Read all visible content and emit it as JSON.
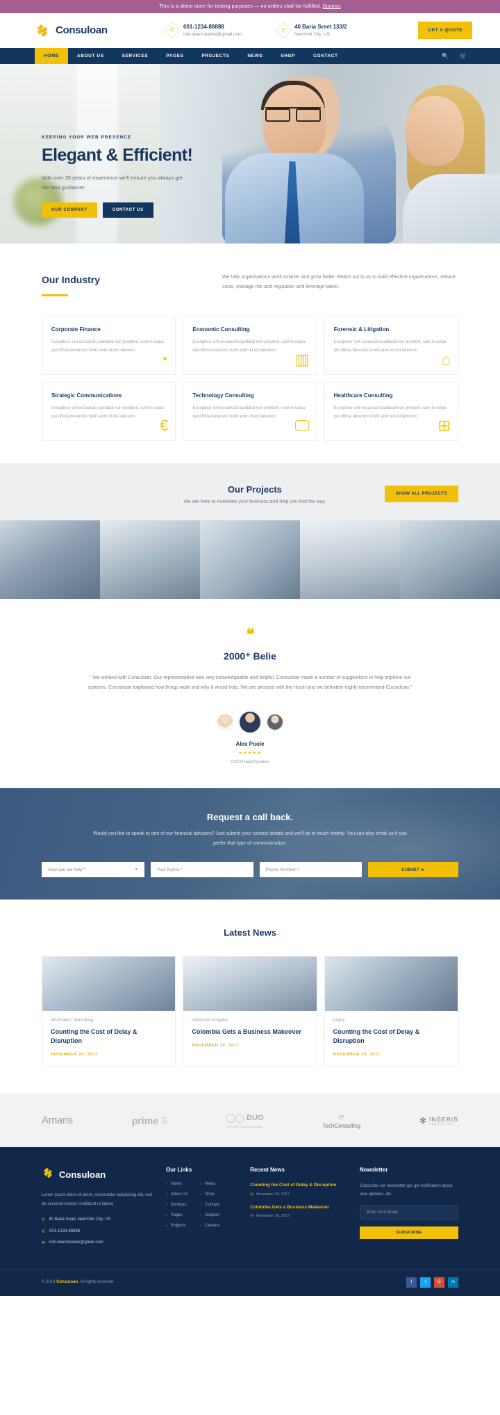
{
  "notice": {
    "text": "This is a demo store for testing purposes — no orders shall be fulfilled.",
    "link": "Dismiss"
  },
  "header": {
    "brand": "Consuloan",
    "phone": {
      "title": "001-1234-88888",
      "sub": "info.deercreative@gmail.com",
      "icon": "phone-icon"
    },
    "address": {
      "title": "40 Baria Sreet 133/2",
      "sub": "NewYork City, US",
      "icon": "map-pin-icon"
    },
    "quote_button": "GET A QUOTE"
  },
  "nav": {
    "items": [
      {
        "label": "HOME",
        "active": true
      },
      {
        "label": "ABOUT US",
        "active": false
      },
      {
        "label": "SERVICES",
        "active": false
      },
      {
        "label": "PAGES",
        "active": false
      },
      {
        "label": "PROJECTS",
        "active": false
      },
      {
        "label": "NEWS",
        "active": false
      },
      {
        "label": "SHOP",
        "active": false
      },
      {
        "label": "CONTACT",
        "active": false
      }
    ],
    "search_icon": "search-icon",
    "cart_icon": "cart-icon"
  },
  "hero": {
    "eyebrow": "KEEPING YOUR WEB PRESENCE",
    "title": "Elegant & Efficient!",
    "subtitle": "With over 20 years of experience we'll ensure you always get the best guidance!",
    "btn_primary": "OUR COMPANY",
    "btn_secondary": "CONTACT US"
  },
  "industry": {
    "title": "Our Industry",
    "description": "We help organisations work smarter and grow faster. Reach out to us to build effective organisations, reduce costs, manage risk and regulation and leverage talent.",
    "body": "Excepteur sint occaecat cupidatat non proident, sunt in culpa qui officia deserunt mollit anim id est laborum",
    "cards": [
      {
        "title": "Corporate Finance",
        "icon": "pie-chart-icon",
        "glyph": "◔"
      },
      {
        "title": "Economic Consulting",
        "icon": "bar-chart-icon",
        "glyph": "▥"
      },
      {
        "title": "Forensic & Litigation",
        "icon": "bell-icon",
        "glyph": "⌂"
      },
      {
        "title": "Strategic Communications",
        "icon": "euro-icon",
        "glyph": "€"
      },
      {
        "title": "Technology Consulting",
        "icon": "monitor-icon",
        "glyph": "🖵"
      },
      {
        "title": "Healthcare Consulting",
        "icon": "medical-case-icon",
        "glyph": "⊞"
      }
    ]
  },
  "projects": {
    "title": "Our Projects",
    "subtitle": "We are here to Acelerate your business and help you find the way.",
    "button": "SHOW ALL PROJECTS",
    "thumbs": [
      "project-thumb-1",
      "project-thumb-2",
      "project-thumb-3",
      "project-thumb-4",
      "project-thumb-5"
    ]
  },
  "testimonial": {
    "quote_icon": "quote-icon",
    "title": "2000⁺ Belie",
    "body": "\" We worked with Consuloan. Our representative was very knowledgeable and helpful. Consuloan made a number of suggestions to help improve our systems. Consuloan explained how things work and why it would help. We are pleased with the result and we definitely highly recommend Consuloan.\"",
    "name": "Alex Poole",
    "stars": "★★★★★",
    "role": "CEO DeerCreative"
  },
  "callback": {
    "title": "Request a call back.",
    "subtitle": "Would you like to speak to one of our financial advisers? Just submit your contact details and we'll be in touch shortly. You can also email us if you prefer that type of communication.",
    "select_placeholder": "How can we help:*",
    "name_placeholder": "Your Name:*",
    "phone_placeholder": "Phone Number:*",
    "submit": "SUBMIT ➤"
  },
  "news": {
    "title": "Latest News",
    "cards": [
      {
        "category": "Information Technology",
        "headline": "Counting the Cost of Delay & Disruption",
        "date": "NOVEMBER 30, 2017",
        "image": "news-image-1"
      },
      {
        "category": "Advanced Analytics",
        "headline": "Colombia Gets a Business Makeover",
        "date": "NOVEMBER 30, 2017",
        "image": "news-image-2"
      },
      {
        "category": "Digital",
        "headline": "Counting the Cost of Delay & Disruption",
        "date": "NOVEMBER 30, 2017",
        "image": "news-image-3"
      }
    ]
  },
  "clients": [
    {
      "name": "Amaris",
      "sub": ""
    },
    {
      "name": "prime",
      "sub": ""
    },
    {
      "name": "DUO",
      "sub": "A CIGNEX Datamatics Company"
    },
    {
      "name": "TechConsulting",
      "sub": ""
    },
    {
      "name": "INGERIS",
      "sub": "CONSULTING"
    }
  ],
  "footer": {
    "brand": "Consuloan",
    "about": "Lorem ipsum dolor sit amet, consectetur adipisicing elit, sed do eiusmod tempor incididunt ut labore",
    "contacts": [
      {
        "icon": "map-pin-icon",
        "text": "40 Baria Sreet, NewYork City, US"
      },
      {
        "icon": "phone-icon",
        "text": "001-1234-88888"
      },
      {
        "icon": "mail-icon",
        "text": "info.deercreative@gmail.com"
      }
    ],
    "links_title": "Our Links",
    "links_col1": [
      "Home",
      "About Us",
      "Services",
      "Pages",
      "Projects"
    ],
    "links_col2": [
      "News",
      "Shop",
      "Contact",
      "Support",
      "Careers"
    ],
    "recent_title": "Recent News",
    "recent": [
      {
        "title": "Counting the Cost of Delay & Disruption",
        "date": "November 30, 2017"
      },
      {
        "title": "Colombia Gets a Business Makeover",
        "date": "November 30, 2017"
      }
    ],
    "newsletter_title": "Newsletter",
    "newsletter_desc": "Subscribe our newsletter gor get notification about new updates, etc.",
    "newsletter_placeholder": "Enter Your Email",
    "newsletter_button": "SUBSCRIBE",
    "copyright_pre": "© 2019",
    "copyright_brand": "Consuloan",
    "copyright_post": ". All rights reserved",
    "social": [
      {
        "name": "facebook-icon",
        "glyph": "f",
        "cls": "s-fb"
      },
      {
        "name": "twitter-icon",
        "glyph": "t",
        "cls": "s-tw"
      },
      {
        "name": "google-plus-icon",
        "glyph": "G",
        "cls": "s-gp"
      },
      {
        "name": "linkedin-icon",
        "glyph": "in",
        "cls": "s-in"
      }
    ]
  },
  "colors": {
    "brand_blue": "#13365f",
    "accent_yellow": "#f2c008",
    "footer_dark": "#11284a",
    "notice_purple": "#a45e91"
  }
}
